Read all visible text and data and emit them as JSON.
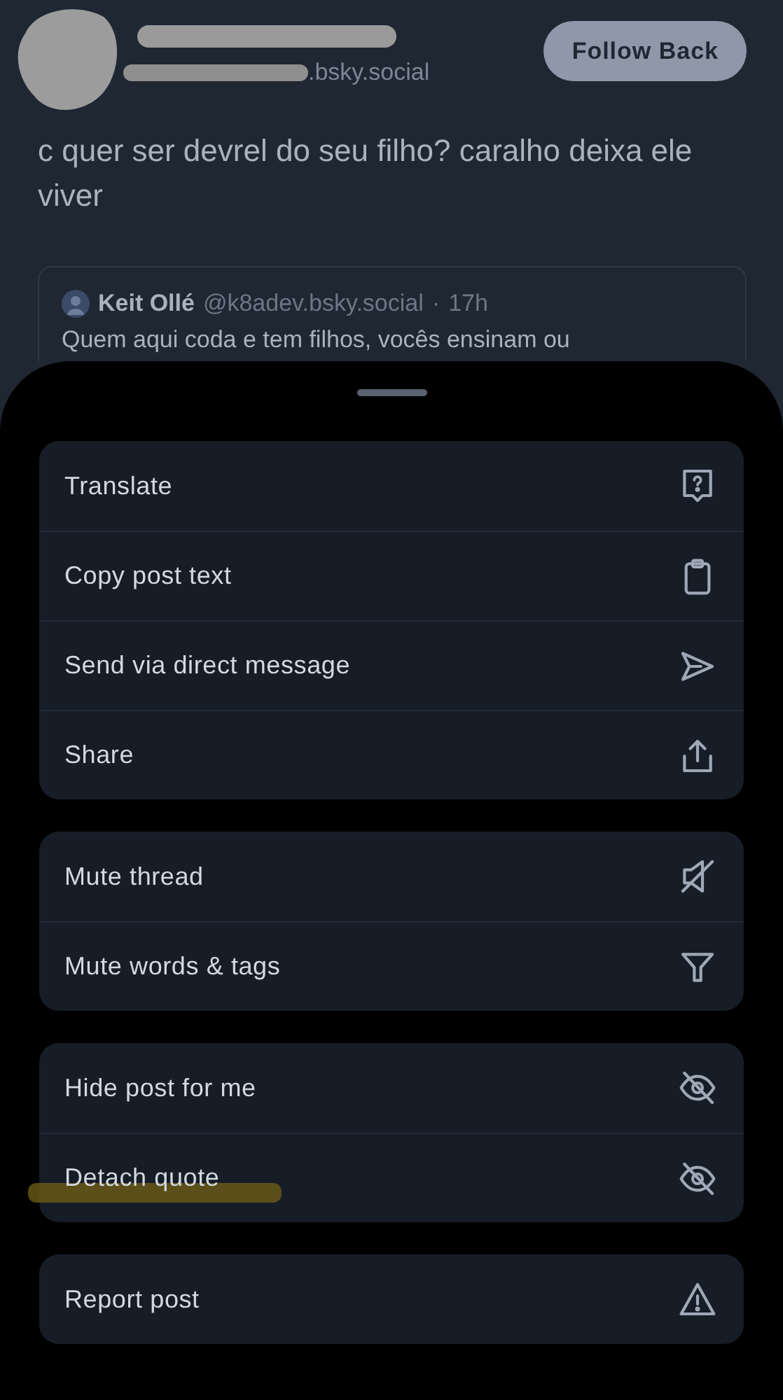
{
  "post": {
    "handle": ".bsky.social",
    "follow_button": "Follow Back",
    "text": "c quer ser devrel do seu filho? caralho deixa ele viver",
    "quote": {
      "author": "Keit Ollé",
      "handle": "@k8adev.bsky.social",
      "separator": "·",
      "time": "17h",
      "text": "Quem aqui coda e tem filhos, vocês ensinam ou"
    }
  },
  "menu": {
    "groups": [
      {
        "items": [
          {
            "label": "Translate",
            "kind": "translate"
          },
          {
            "label": "Copy post text",
            "kind": "copy"
          },
          {
            "label": "Send via direct message",
            "kind": "send"
          },
          {
            "label": "Share",
            "kind": "share"
          }
        ]
      },
      {
        "items": [
          {
            "label": "Mute thread",
            "kind": "mute"
          },
          {
            "label": "Mute words & tags",
            "kind": "filter"
          }
        ]
      },
      {
        "items": [
          {
            "label": "Hide post for me",
            "kind": "hide",
            "highlighted": false
          },
          {
            "label": "Detach quote",
            "kind": "hide",
            "highlighted": true
          }
        ]
      },
      {
        "items": [
          {
            "label": "Report post",
            "kind": "report"
          }
        ]
      }
    ]
  }
}
